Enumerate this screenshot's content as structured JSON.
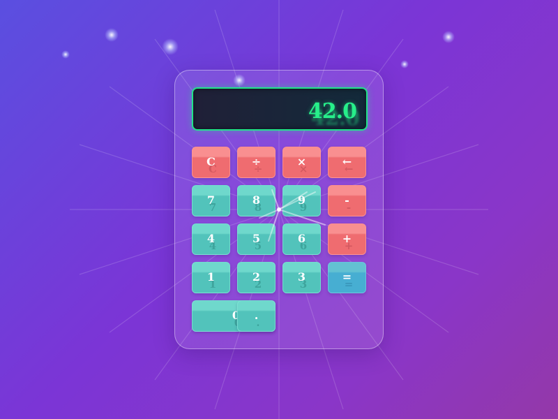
{
  "display": {
    "value": "42.0"
  },
  "keypad": {
    "clear": "C",
    "divide": "÷",
    "multiply": "×",
    "backspace": "←",
    "seven": "7",
    "eight": "8",
    "nine": "9",
    "minus": "-",
    "four": "4",
    "five": "5",
    "six": "6",
    "plus": "+",
    "one": "1",
    "two": "2",
    "three": "3",
    "equals": "=",
    "zero": "0",
    "decimal": "."
  },
  "colors": {
    "operator_key": "#ef6c70",
    "number_key": "#52c3bb",
    "equals_key": "#47aed2",
    "display_text": "#27ef8a",
    "display_border": "#22e38a"
  }
}
